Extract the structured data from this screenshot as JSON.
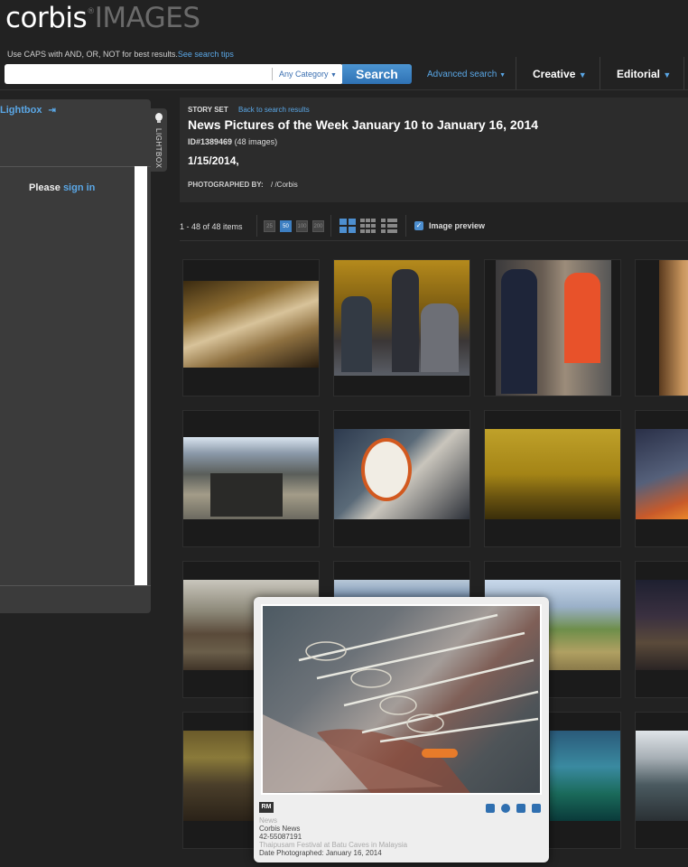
{
  "header": {
    "logo_main": "corbis",
    "logo_sub": "IMAGES",
    "logo_reg": "®",
    "tips_text": "Use CAPS with AND, OR, NOT for best results.",
    "tips_link": "See search tips",
    "search_value": "",
    "category": "Any Category",
    "search_button": "Search",
    "advanced": "Advanced search",
    "nav": [
      {
        "label": "Creative"
      },
      {
        "label": "Editorial"
      }
    ]
  },
  "lightbox": {
    "title": "Lightbox",
    "signin_prefix": "Please",
    "signin_link": "sign in",
    "tab_label": "LIGHTBOX"
  },
  "story": {
    "label": "STORY SET",
    "back": "Back to search results",
    "title": "News Pictures of the Week January 10 to January 16, 2014",
    "id": "ID#1389469",
    "count": "(48 images)",
    "date": "1/15/2014,",
    "photographed_label": "PHOTOGRAPHED BY:",
    "photographed_value": "/ /Corbis"
  },
  "toolbar": {
    "items_text": "1 - 48 of 48 items",
    "per_page": [
      "25",
      "50",
      "100",
      "200"
    ],
    "per_page_active": "50",
    "image_preview": "Image preview"
  },
  "grid": {
    "tiles": [
      {
        "name": "veiled-figure"
      },
      {
        "name": "football-awards"
      },
      {
        "name": "state-couple"
      },
      {
        "name": "portrait-woman"
      },
      {
        "name": "crowd-truck"
      },
      {
        "name": "protest-poster"
      },
      {
        "name": "yellow-sky-birds"
      },
      {
        "name": "fire-clouds"
      },
      {
        "name": "debris-street"
      },
      {
        "name": "flag-building"
      },
      {
        "name": "field-people"
      },
      {
        "name": "night-crowd"
      },
      {
        "name": "market-people"
      },
      {
        "name": "hidden"
      },
      {
        "name": "river-bathers"
      },
      {
        "name": "snowy-river"
      }
    ]
  },
  "popup": {
    "badge": "RM",
    "category": "News",
    "collection": "Corbis News",
    "image_id": "42-55087191",
    "caption": "Thaipusam Festival at Batu Caves in Malaysia",
    "date_label": "Date Photographed:",
    "date_value": "January 16, 2014"
  },
  "colors": {
    "accent": "#4d8fd0",
    "background": "#222222",
    "panel": "#3b3b3b"
  }
}
